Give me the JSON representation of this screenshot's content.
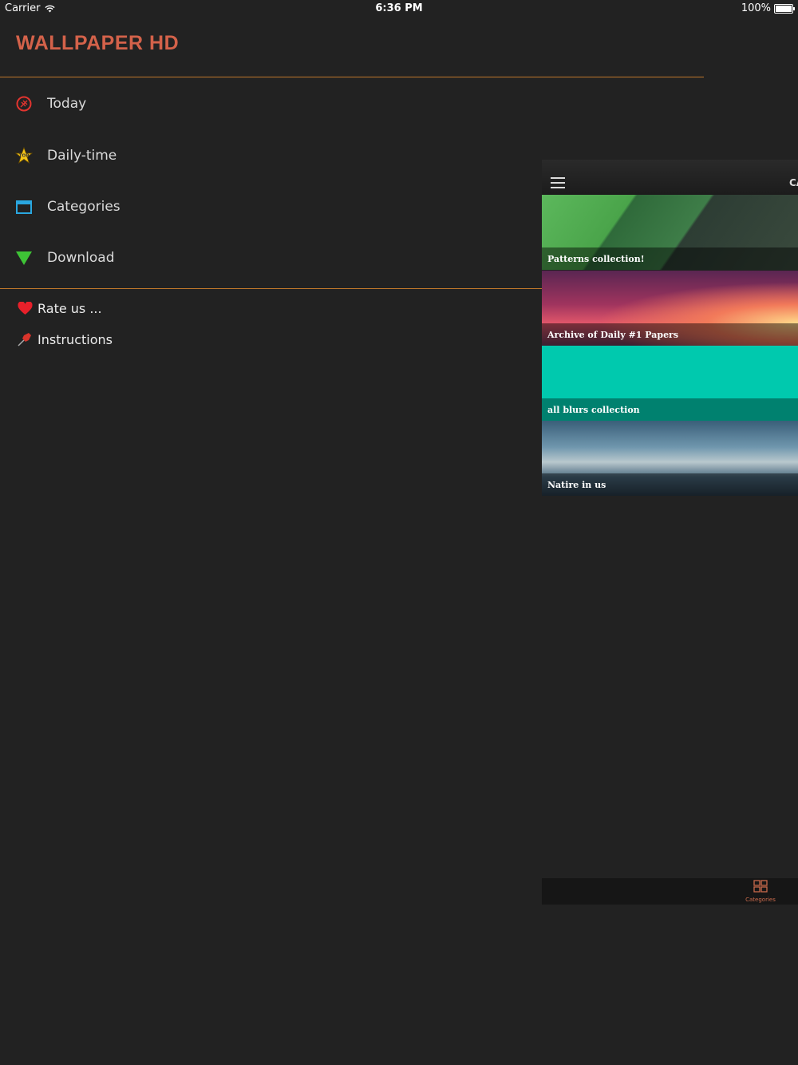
{
  "status_bar": {
    "carrier": "Carrier",
    "time": "6:36 PM",
    "battery": "100%"
  },
  "app": {
    "title": "WALLPAPER HD"
  },
  "menu": {
    "items": [
      {
        "label": "Today",
        "icon": "soccer-ball-icon"
      },
      {
        "label": "Daily-time",
        "icon": "top-star-icon"
      },
      {
        "label": "Categories",
        "icon": "window-icon"
      },
      {
        "label": "Download",
        "icon": "download-triangle-icon"
      }
    ],
    "extras": [
      {
        "label": "Rate us ...",
        "icon": "heart-icon"
      },
      {
        "label": "Instructions",
        "icon": "pushpin-icon"
      }
    ]
  },
  "panel": {
    "title": "CA",
    "tiles": [
      {
        "caption": "Patterns collection!"
      },
      {
        "caption": "Archive of Daily #1 Papers"
      },
      {
        "caption": "all blurs collection"
      },
      {
        "caption": "Natire in us"
      }
    ],
    "tab": {
      "label": "Categories"
    }
  },
  "colors": {
    "accent": "#d4624a",
    "divider": "#c0772a",
    "background": "#222222"
  }
}
